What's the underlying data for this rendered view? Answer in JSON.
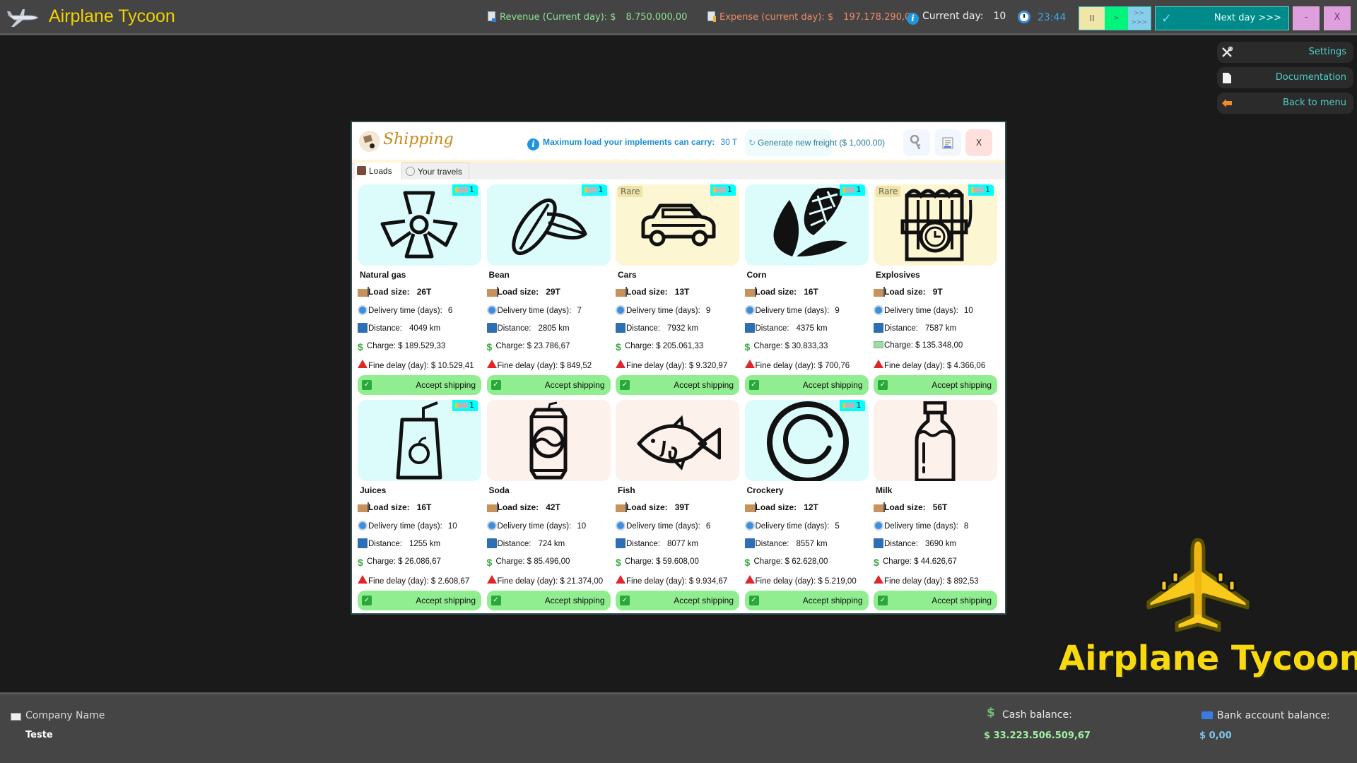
{
  "app": {
    "title": "Airplane Tycoon"
  },
  "topbar": {
    "revenue_label": "Revenue (Current day): $",
    "revenue_value": "8.750.000,00",
    "expense_label": "Expense (current day): $",
    "expense_value": "197.178.290,00",
    "current_day_label": "Current day:",
    "current_day_value": "10",
    "time": "23:44",
    "speed": {
      "pause": "II",
      "play": ">",
      "fast_1": ">>",
      "fast_2": ">>>"
    },
    "next_day_label": "Next day >>>",
    "minimize_label": "-",
    "close_label": "X"
  },
  "side_menu": [
    {
      "label": "Settings",
      "icon": "wrench-screwdriver-icon"
    },
    {
      "label": "Documentation",
      "icon": "document-icon"
    },
    {
      "label": "Back to menu",
      "icon": "arrow-left-icon"
    }
  ],
  "modal": {
    "title": "Shipping",
    "max_load_label": "Maximum load your implements can carry:",
    "max_load_value": "30 T",
    "generate_label": "Generate new freight ($ 1,000.00)",
    "close_label": "X",
    "tabs": [
      {
        "label": "Loads",
        "active": true
      },
      {
        "label": "Your travels",
        "active": false
      }
    ],
    "field_labels": {
      "load_size": "Load size:",
      "delivery": "Delivery time (days):",
      "distance": "Distance:",
      "charge": "Charge: $",
      "fine": "Fine delay (day): $",
      "accept": "Accept shipping",
      "rare": "Rare"
    },
    "loads": [
      {
        "name": "Natural gas",
        "load": "26T",
        "delivery": "6",
        "distance": "4049 km",
        "charge": "189.529,33",
        "fine": "10.529,41",
        "bg": "cyan",
        "rare": false,
        "trucks": "1",
        "icon": "radiation-icon"
      },
      {
        "name": "Bean",
        "load": "29T",
        "delivery": "7",
        "distance": "2805 km",
        "charge": "23.786,67",
        "fine": "849,52",
        "bg": "cyan",
        "rare": false,
        "trucks": "1",
        "icon": "bean-icon"
      },
      {
        "name": "Cars",
        "load": "13T",
        "delivery": "9",
        "distance": "7932 km",
        "charge": "205.061,33",
        "fine": "9.320,97",
        "bg": "yellow",
        "rare": true,
        "trucks": "1",
        "icon": "car-icon"
      },
      {
        "name": "Corn",
        "load": "16T",
        "delivery": "9",
        "distance": "4375 km",
        "charge": "30.833,33",
        "fine": "700,76",
        "bg": "cyan",
        "rare": false,
        "trucks": "1",
        "icon": "corn-icon"
      },
      {
        "name": "Explosives",
        "load": "9T",
        "delivery": "10",
        "distance": "7587 km",
        "charge": "135.348,00",
        "fine": "4.366,06",
        "bg": "yellow",
        "rare": true,
        "trucks": "1",
        "icon": "dynamite-icon"
      },
      {
        "name": "Juices",
        "load": "16T",
        "delivery": "10",
        "distance": "1255 km",
        "charge": "26.086,67",
        "fine": "2.608,67",
        "bg": "cyan",
        "rare": false,
        "trucks": "1",
        "icon": "juice-box-icon"
      },
      {
        "name": "Soda",
        "load": "42T",
        "delivery": "10",
        "distance": "724 km",
        "charge": "85.496,00",
        "fine": "21.374,00",
        "bg": "peach",
        "rare": false,
        "trucks": null,
        "icon": "soda-can-icon"
      },
      {
        "name": "Fish",
        "load": "39T",
        "delivery": "6",
        "distance": "8077 km",
        "charge": "59.608,00",
        "fine": "9.934,67",
        "bg": "peach",
        "rare": false,
        "trucks": null,
        "icon": "fish-icon"
      },
      {
        "name": "Crockery",
        "load": "12T",
        "delivery": "5",
        "distance": "8557 km",
        "charge": "62.628,00",
        "fine": "5.219,00",
        "bg": "cyan",
        "rare": false,
        "trucks": "1",
        "icon": "plate-icon"
      },
      {
        "name": "Milk",
        "load": "56T",
        "delivery": "8",
        "distance": "3690 km",
        "charge": "44.626,67",
        "fine": "892,53",
        "bg": "peach",
        "rare": false,
        "trucks": null,
        "icon": "milk-bottle-icon"
      }
    ]
  },
  "brand": {
    "text": "Airplane Tycoon"
  },
  "footer": {
    "company_label": "Company Name",
    "company_value": "Teste",
    "cash_label": "Cash balance:",
    "cash_value": "$  33.223.506.509,67",
    "bank_label": "Bank account balance:",
    "bank_value": "$  0,00"
  }
}
